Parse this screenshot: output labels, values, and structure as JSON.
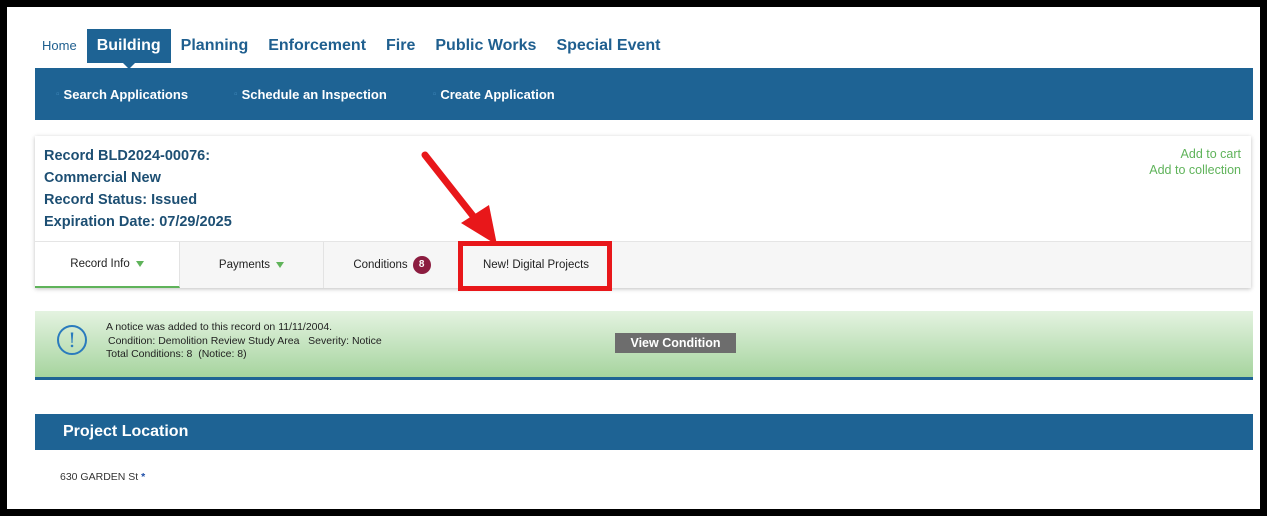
{
  "top_tabs": {
    "home": "Home",
    "building": "Building",
    "planning": "Planning",
    "enforcement": "Enforcement",
    "fire": "Fire",
    "public_works": "Public Works",
    "special_event": "Special Event"
  },
  "subnav": {
    "search": "Search Applications",
    "schedule": "Schedule an Inspection",
    "create": "Create Application"
  },
  "record": {
    "number": "Record BLD2024-00076:",
    "type": "Commercial New",
    "status": "Record Status: Issued",
    "expiration": "Expiration Date: 07/29/2025",
    "add_to_cart": "Add to cart",
    "add_to_collection": "Add to collection"
  },
  "record_tabs": {
    "record_info": "Record Info",
    "payments": "Payments",
    "conditions": "Conditions",
    "conditions_count": "8",
    "digital_projects": "New! Digital Projects"
  },
  "notice": {
    "line1": "A notice was added to this record on 11/11/2004.",
    "line2": "Condition: Demolition Review Study Area   Severity: Notice",
    "line3": "Total Conditions: 8  (Notice: 8)",
    "button": "View Condition"
  },
  "location": {
    "title": "Project Location",
    "address": "630 GARDEN St",
    "marker": "*"
  },
  "colors": {
    "primary_blue": "#1e6394",
    "accent_green": "#5fb35a",
    "badge": "#8c1d40",
    "annotation_red": "#e8171a"
  }
}
